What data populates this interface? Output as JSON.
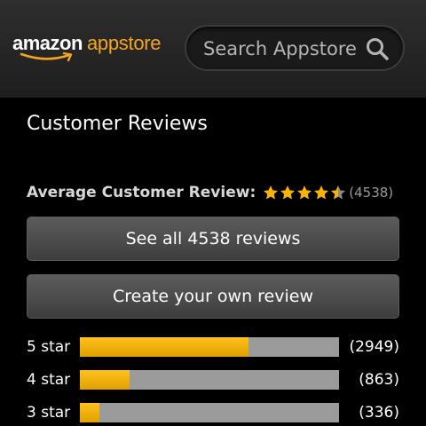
{
  "header": {
    "logo_amazon": "amazon",
    "logo_appstore": "appstore",
    "search_placeholder": "Search Appstore",
    "search_icon": "search-icon"
  },
  "reviews": {
    "title": "Customer Reviews",
    "average_label": "Average Customer Review:",
    "average_rating": 4.5,
    "average_count": "(4538)",
    "see_all_label": "See all 4538 reviews",
    "create_label": "Create your own review",
    "breakdown": [
      {
        "label": "5 star",
        "count": "(2949)",
        "fraction": 0.6499
      },
      {
        "label": "4 star",
        "count": "(863)",
        "fraction": 0.1902
      },
      {
        "label": "3 star",
        "count": "(336)",
        "fraction": 0.074
      }
    ]
  },
  "colors": {
    "accent": "#f4a51c",
    "bar_fill": "#f0b000",
    "bar_track": "#9b9b9b",
    "header_bg": "#262626",
    "page_bg": "#000000"
  }
}
